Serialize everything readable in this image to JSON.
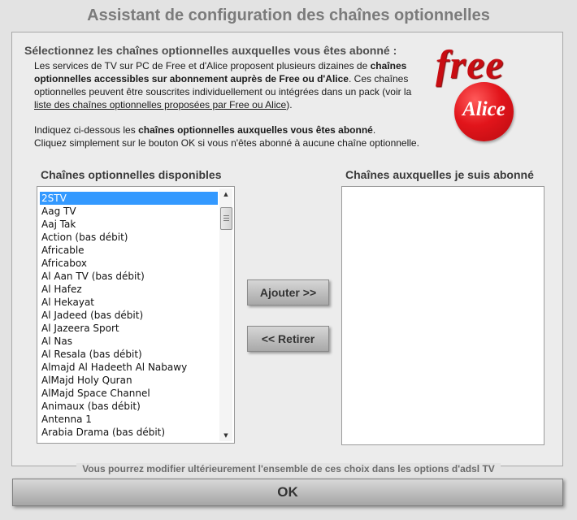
{
  "window": {
    "title": "Assistant de configuration des chaînes optionnelles"
  },
  "intro": {
    "heading": "Sélectionnez les chaînes optionnelles auxquelles vous êtes abonné :",
    "p1_a": "Les services de TV sur PC de Free et d'Alice proposent plusieurs dizaines de ",
    "p1_b": "chaînes optionnelles accessibles sur abonnement auprès de Free ou d'Alice",
    "p1_c": ". Ces chaînes optionnelles peuvent être souscrites individuellement ou intégrées dans un pack (voir la ",
    "p1_link": "liste des chaînes optionnelles proposées par Free ou Alice",
    "p1_d": ").",
    "p2_a": "Indiquez ci-dessous les ",
    "p2_b": "chaînes optionnelles auxquelles vous êtes abonné",
    "p2_c": ".",
    "p3": "Cliquez simplement sur le bouton OK si vous n'êtes abonné à aucune chaîne optionnelle."
  },
  "logos": {
    "free": "free",
    "alice": "Alice"
  },
  "available": {
    "label": "Chaînes optionnelles disponibles",
    "items": [
      "2STV",
      "Aag TV",
      "Aaj Tak",
      "Action (bas débit)",
      "Africable",
      "Africabox",
      "Al Aan TV (bas débit)",
      "Al Hafez",
      "Al Hekayat",
      "Al Jadeed (bas débit)",
      "Al Jazeera Sport",
      "Al Nas",
      "Al Resala (bas débit)",
      "Almajd Al Hadeeth Al Nabawy",
      "AlMajd Holy Quran",
      "AlMajd Space Channel",
      "Animaux (bas débit)",
      "Antenna 1",
      "Arabia Drama (bas débit)"
    ],
    "selected_index": 0
  },
  "subscribed": {
    "label": "Chaînes auxquelles je suis abonné",
    "items": []
  },
  "buttons": {
    "add": "Ajouter >>",
    "remove": "<< Retirer",
    "ok": "OK"
  },
  "footer": {
    "note": "Vous pourrez modifier ultérieurement l'ensemble de ces choix dans les options d'adsl TV"
  },
  "colors": {
    "selection": "#3399ff",
    "free_red": "#c80c12",
    "alice_red": "#e2151b"
  }
}
